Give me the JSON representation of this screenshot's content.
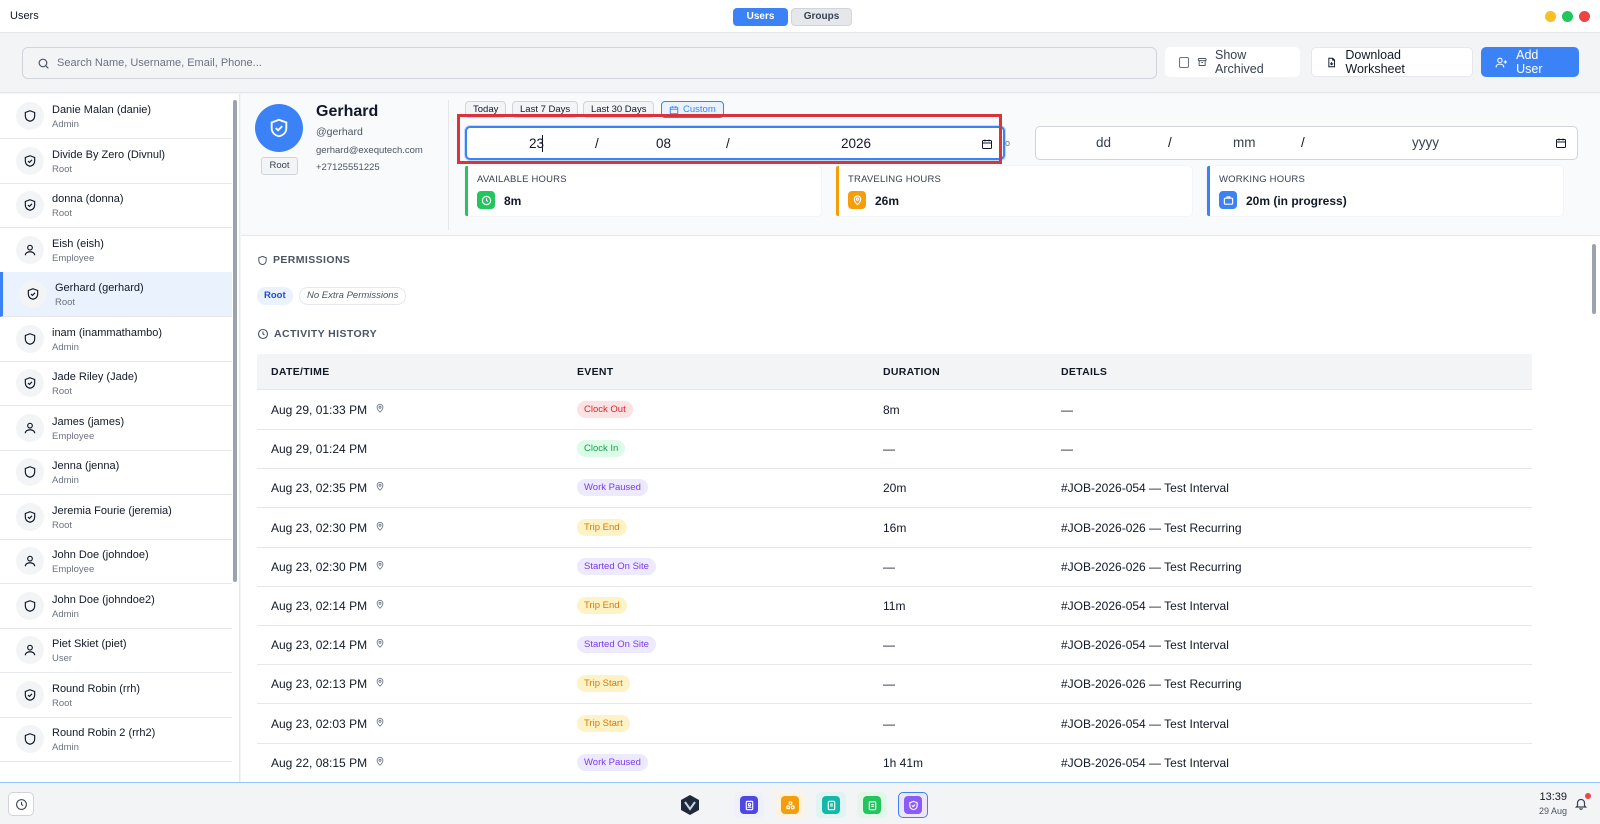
{
  "window": {
    "title": "Users",
    "tabs": [
      "Users",
      "Groups"
    ],
    "controls": {
      "minimize_color": "#fbbf24",
      "maximize_color": "#22c55e",
      "close_color": "#ef4444"
    }
  },
  "toolbar": {
    "search_placeholder": "Search Name, Username, Email, Phone...",
    "show_archived_label": "Show Archived",
    "download_label": "Download Worksheet",
    "add_user_label": "Add User"
  },
  "users": [
    {
      "name": "Danie Malan (danie)",
      "role": "Admin",
      "icon": "shield-icon"
    },
    {
      "name": "Divide By Zero (Divnul)",
      "role": "Root",
      "icon": "shield-check-icon"
    },
    {
      "name": "donna (donna)",
      "role": "Root",
      "icon": "shield-check-icon"
    },
    {
      "name": "Eish (eish)",
      "role": "Employee",
      "icon": "person-icon"
    },
    {
      "name": "Gerhard (gerhard)",
      "role": "Root",
      "icon": "shield-check-icon",
      "selected": true
    },
    {
      "name": "inam (inammathambo)",
      "role": "Admin",
      "icon": "shield-icon"
    },
    {
      "name": "Jade Riley (Jade)",
      "role": "Root",
      "icon": "shield-check-icon"
    },
    {
      "name": "James (james)",
      "role": "Employee",
      "icon": "person-icon"
    },
    {
      "name": "Jenna (jenna)",
      "role": "Admin",
      "icon": "shield-icon"
    },
    {
      "name": "Jeremia Fourie (jeremia)",
      "role": "Root",
      "icon": "shield-check-icon"
    },
    {
      "name": "John Doe (johndoe)",
      "role": "Employee",
      "icon": "person-icon"
    },
    {
      "name": "John Doe (johndoe2)",
      "role": "Admin",
      "icon": "shield-icon"
    },
    {
      "name": "Piet Skiet (piet)",
      "role": "User",
      "icon": "person-icon"
    },
    {
      "name": "Round Robin (rrh)",
      "role": "Root",
      "icon": "shield-check-icon"
    },
    {
      "name": "Round Robin 2 (rrh2)",
      "role": "Admin",
      "icon": "shield-icon"
    }
  ],
  "profile": {
    "name": "Gerhard",
    "username": "@gerhard",
    "email": "gerhard@exequtech.com",
    "phone": "+27125551225",
    "role": "Root"
  },
  "ranges": [
    "Today",
    "Last 7 Days",
    "Last 30 Days",
    "Custom"
  ],
  "date_from": {
    "day": "23",
    "month": "08",
    "year": "2026"
  },
  "date_to": {
    "day": "dd",
    "month": "mm",
    "year": "yyyy"
  },
  "date_separator": "/",
  "to_separator": "o",
  "stats": [
    {
      "label": "AVAILABLE HOURS",
      "value": "8m",
      "color": "#22c55e",
      "icon": "clock-icon"
    },
    {
      "label": "TRAVELING HOURS",
      "value": "26m",
      "color": "#f59e0b",
      "icon": "location-pin-icon"
    },
    {
      "label": "WORKING HOURS",
      "value": "20m (in progress)",
      "color": "#3b82f6",
      "icon": "briefcase-icon"
    }
  ],
  "permissions": {
    "title": "PERMISSIONS",
    "role_tag": "Root",
    "note": "No Extra Permissions"
  },
  "activity": {
    "title": "ACTIVITY HISTORY",
    "columns": [
      "DATE/TIME",
      "EVENT",
      "DURATION",
      "DETAILS"
    ],
    "rows": [
      {
        "datetime": "Aug 29, 01:33 PM",
        "pin": true,
        "event": "Clock Out",
        "kind": "red",
        "duration": "8m",
        "details": "—"
      },
      {
        "datetime": "Aug 29, 01:24 PM",
        "pin": false,
        "event": "Clock In",
        "kind": "green",
        "duration": "—",
        "details": "—"
      },
      {
        "datetime": "Aug 23, 02:35 PM",
        "pin": true,
        "event": "Work Paused",
        "kind": "purple",
        "duration": "20m",
        "details": "#JOB-2026-054 — Test Interval"
      },
      {
        "datetime": "Aug 23, 02:30 PM",
        "pin": true,
        "event": "Trip End",
        "kind": "orange",
        "duration": "16m",
        "details": "#JOB-2026-026 — Test Recurring"
      },
      {
        "datetime": "Aug 23, 02:30 PM",
        "pin": true,
        "event": "Started On Site",
        "kind": "purple",
        "duration": "—",
        "details": "#JOB-2026-026 — Test Recurring"
      },
      {
        "datetime": "Aug 23, 02:14 PM",
        "pin": true,
        "event": "Trip End",
        "kind": "orange",
        "duration": "11m",
        "details": "#JOB-2026-054 — Test Interval"
      },
      {
        "datetime": "Aug 23, 02:14 PM",
        "pin": true,
        "event": "Started On Site",
        "kind": "purple",
        "duration": "—",
        "details": "#JOB-2026-054 — Test Interval"
      },
      {
        "datetime": "Aug 23, 02:13 PM",
        "pin": true,
        "event": "Trip Start",
        "kind": "orange",
        "duration": "—",
        "details": "#JOB-2026-026 — Test Recurring"
      },
      {
        "datetime": "Aug 23, 02:03 PM",
        "pin": true,
        "event": "Trip Start",
        "kind": "orange",
        "duration": "—",
        "details": "#JOB-2026-054 — Test Interval"
      },
      {
        "datetime": "Aug 22, 08:15 PM",
        "pin": true,
        "event": "Work Paused",
        "kind": "purple",
        "duration": "1h 41m",
        "details": "#JOB-2026-054 — Test Interval"
      }
    ]
  },
  "taskbar": {
    "time": "13:39",
    "date": "29 Aug",
    "apps": [
      "logo-icon",
      "contacts-icon",
      "modules-icon",
      "document-icon",
      "clipboard-icon",
      "shield-app-icon"
    ]
  }
}
